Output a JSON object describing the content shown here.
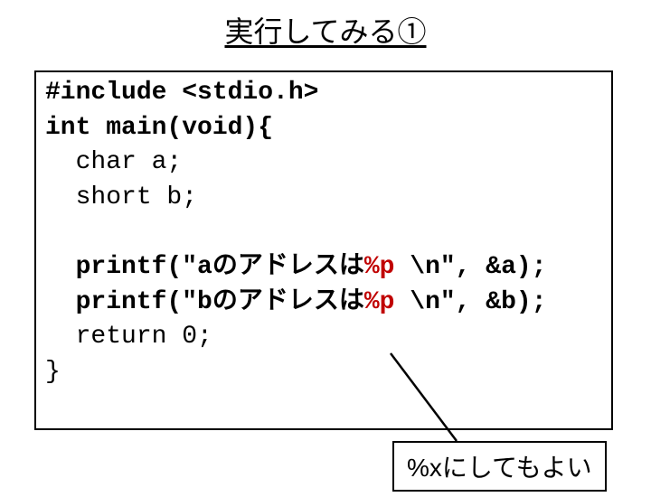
{
  "title": "実行してみる①",
  "code": {
    "include_kw": "#include",
    "include_hdr": " <stdio.h>",
    "main_sig": "int main(void){",
    "decl_a": "  char a;",
    "decl_b": "  short b;",
    "blank": "",
    "p1_pre": "  printf(\"a",
    "p1_jp": "のアドレスは",
    "p1_fmt": "%p",
    "p1_post": " \\n\", &a);",
    "p2_pre": "  printf(\"b",
    "p2_jp": "のアドレスは",
    "p2_fmt": "%p",
    "p2_post": " \\n\", &b);",
    "ret": "  return 0;",
    "close": "}"
  },
  "callout": "%xにしてもよい"
}
